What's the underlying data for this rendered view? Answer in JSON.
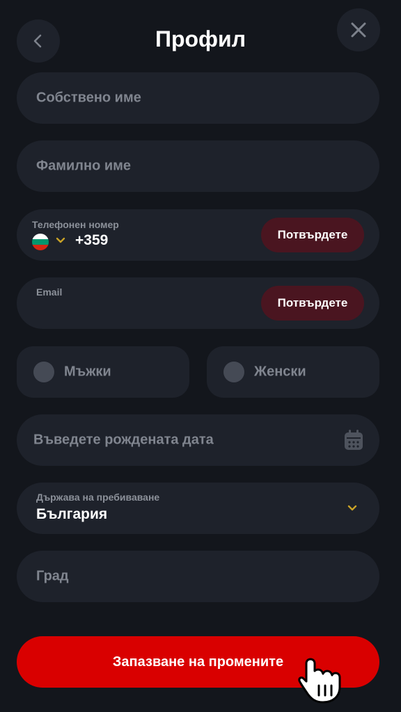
{
  "header": {
    "title": "Профил",
    "back_icon": "chevron-left-icon",
    "close_icon": "close-icon"
  },
  "form": {
    "first_name_placeholder": "Собствено име",
    "last_name_placeholder": "Фамилно име",
    "phone": {
      "label": "Телефонен номер",
      "country_code": "+359",
      "flag_icon": "bulgaria-flag-icon",
      "confirm_label": "Потвърдете"
    },
    "email": {
      "label": "Email",
      "value": "",
      "confirm_label": "Потвърдете"
    },
    "gender": {
      "male_label": "Мъжки",
      "female_label": "Женски"
    },
    "birthdate_placeholder": "Въведете рождената дата",
    "birthdate_icon": "calendar-icon",
    "country": {
      "label": "Държава на пребиваване",
      "value": "България",
      "dropdown_icon": "chevron-down-icon"
    },
    "city_placeholder": "Град"
  },
  "actions": {
    "save_label": "Запазване на промените"
  },
  "colors": {
    "background": "#13161c",
    "field": "#1e222b",
    "primary": "#d90000",
    "confirm": "#4a1520",
    "accent_chevron": "#c9a227",
    "placeholder": "#80858f"
  }
}
